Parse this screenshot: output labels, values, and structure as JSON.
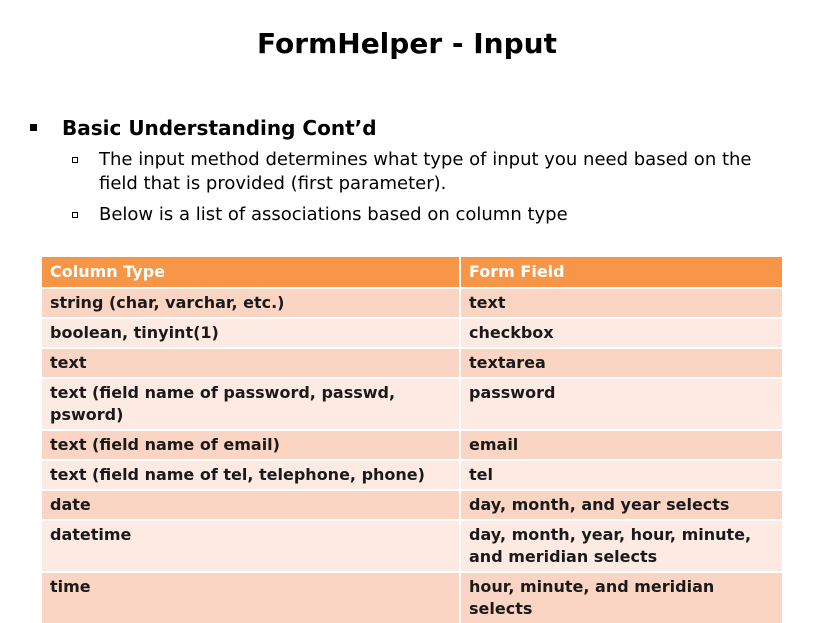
{
  "title": "FormHelper - Input",
  "bullet": {
    "heading": "Basic Understanding Cont’d",
    "items": [
      "The input method determines what type of input you need based on the field that is provided (first parameter).",
      "Below is a list of associations based on column type"
    ]
  },
  "table": {
    "headers": [
      "Column Type",
      "Form Field"
    ],
    "rows": [
      [
        "string (char, varchar, etc.)",
        "text"
      ],
      [
        "boolean, tinyint(1)",
        "checkbox"
      ],
      [
        "text",
        "textarea"
      ],
      [
        "text (field name of password, passwd, psword)",
        "password"
      ],
      [
        "text (field name of email)",
        "email"
      ],
      [
        "text (field name of tel, telephone, phone)",
        "tel"
      ],
      [
        "date",
        "day, month, and year selects"
      ],
      [
        "datetime",
        "day, month, year, hour, minute, and meridian selects"
      ],
      [
        "time",
        "hour, minute, and meridian selects"
      ]
    ]
  },
  "colors": {
    "header_bg": "#f79646",
    "row_odd_bg": "#fbd5c3",
    "row_even_bg": "#fdebe3"
  }
}
